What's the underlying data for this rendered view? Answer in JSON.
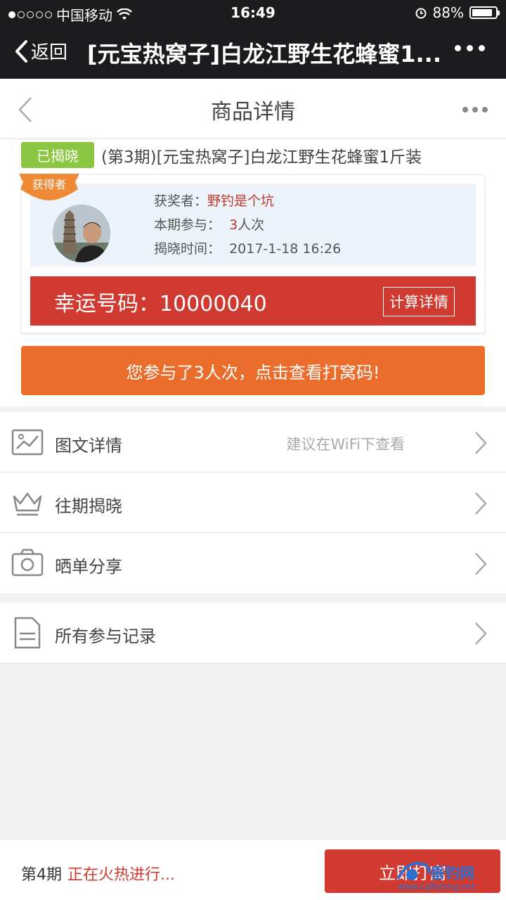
{
  "status_bar": {
    "carrier": "中国移动",
    "time": "16:49",
    "battery": "88%",
    "battery_level": 0.88
  },
  "wechat_nav": {
    "back_label": "返回",
    "title": "[元宝热窝子]白龙江野生花蜂蜜1..."
  },
  "page_header": {
    "title": "商品详情"
  },
  "product": {
    "status_badge": "已揭晓",
    "name": "(第3期)[元宝热窝子]白龙江野生花蜂蜜1斤装"
  },
  "winner": {
    "ribbon": "获得者",
    "winner_label": "获奖者：",
    "winner_name": "野钓是个坑",
    "participation_label": "本期参与：",
    "participation_count": "3",
    "participation_unit": "人次",
    "reveal_label": "揭晓时间：",
    "reveal_time": "2017-1-18 16:26"
  },
  "lucky": {
    "label": "幸运号码：",
    "number": "10000040",
    "calc_button": "计算详情"
  },
  "participate_button": "您参与了3人次，点击查看打窝码!",
  "menu_group1": [
    {
      "label": "图文详情",
      "hint": "建议在WiFi下查看",
      "icon": "image-icon"
    },
    {
      "label": "往期揭晓",
      "hint": "",
      "icon": "crown-icon"
    },
    {
      "label": "晒单分享",
      "hint": "",
      "icon": "camera-icon"
    }
  ],
  "menu_group2": [
    {
      "label": "所有参与记录",
      "hint": "",
      "icon": "document-icon"
    }
  ],
  "bottom_bar": {
    "period": "第4期",
    "status": "正在火热进行...",
    "buy_button": "立即打窝"
  },
  "watermark": {
    "name": "垂钓网",
    "url": "www.cqfishing.net"
  },
  "colors": {
    "accent_red": "#d03a30",
    "orange": "#ea6d2c",
    "badge_green": "#8ac63f"
  }
}
